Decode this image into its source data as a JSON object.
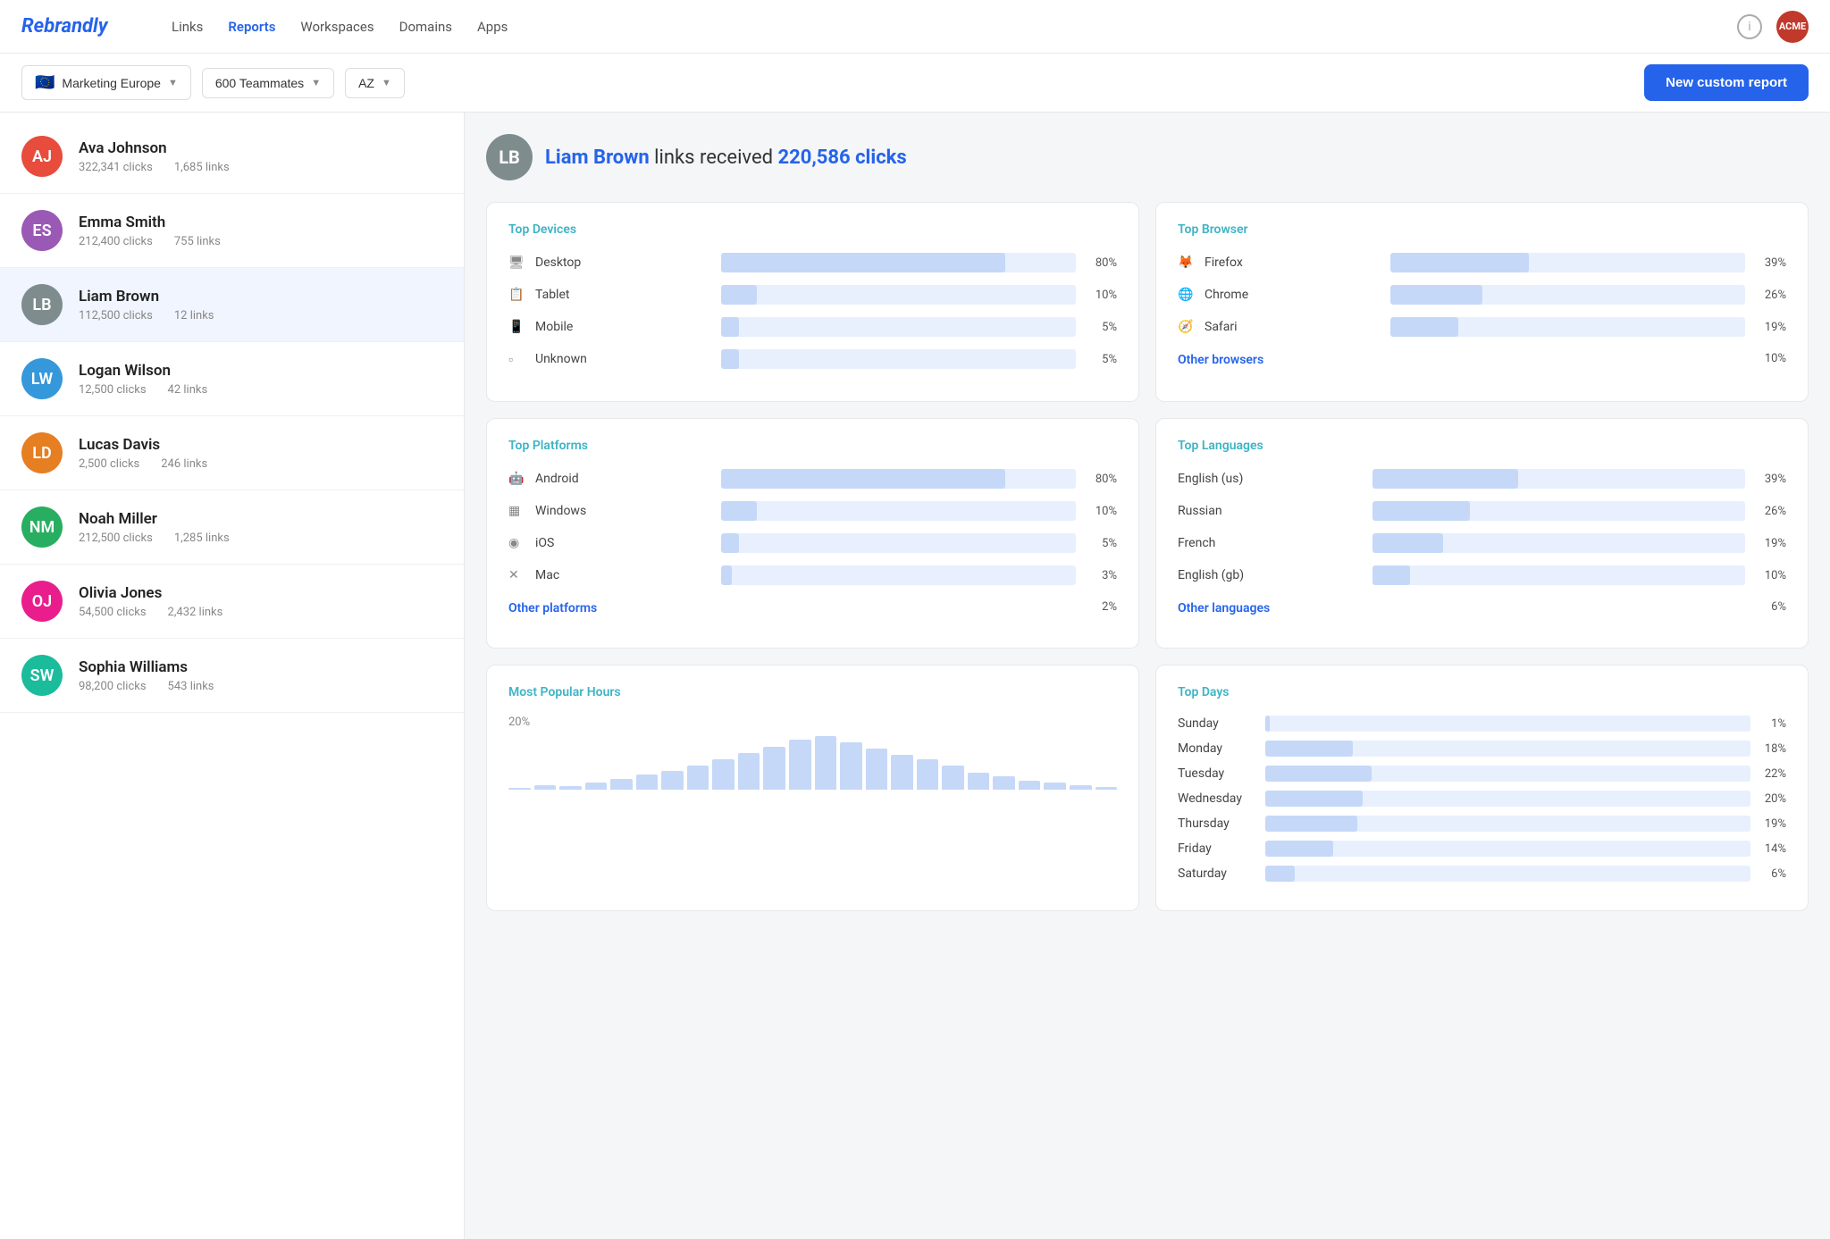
{
  "brand": "Rebrandly",
  "nav": {
    "links": [
      "Links",
      "Reports",
      "Workspaces",
      "Domains",
      "Apps"
    ],
    "active": "Reports"
  },
  "toolbar": {
    "workspace": "Marketing Europe",
    "teammates": "600 Teammates",
    "filter": "AZ",
    "new_report_label": "New custom report"
  },
  "users": [
    {
      "name": "Ava Johnson",
      "clicks": "322,341 clicks",
      "links": "1,685 links",
      "initials": "AJ",
      "color": "av-red"
    },
    {
      "name": "Emma Smith",
      "clicks": "212,400 clicks",
      "links": "755 links",
      "initials": "ES",
      "color": "av-purple"
    },
    {
      "name": "Liam Brown",
      "clicks": "112,500 clicks",
      "links": "12 links",
      "initials": "LB",
      "color": "av-gray",
      "selected": true
    },
    {
      "name": "Logan Wilson",
      "clicks": "12,500 clicks",
      "links": "42 links",
      "initials": "LW",
      "color": "av-blue"
    },
    {
      "name": "Lucas Davis",
      "clicks": "2,500 clicks",
      "links": "246 links",
      "initials": "LD",
      "color": "av-orange"
    },
    {
      "name": "Noah Miller",
      "clicks": "212,500 clicks",
      "links": "1,285 links",
      "initials": "NM",
      "color": "av-green"
    },
    {
      "name": "Olivia Jones",
      "clicks": "54,500 clicks",
      "links": "2,432 links",
      "initials": "OJ",
      "color": "av-pink"
    },
    {
      "name": "Sophia Williams",
      "clicks": "98,200 clicks",
      "links": "543 links",
      "initials": "SW",
      "color": "av-teal"
    }
  ],
  "selected_user": {
    "name": "Liam Brown",
    "clicks": "220,586 clicks",
    "initials": "LB",
    "color": "av-gray"
  },
  "top_devices": {
    "title": "Top Devices",
    "items": [
      {
        "label": "Desktop",
        "pct": 80,
        "pct_label": "80%"
      },
      {
        "label": "Tablet",
        "pct": 10,
        "pct_label": "10%"
      },
      {
        "label": "Mobile",
        "pct": 5,
        "pct_label": "5%"
      },
      {
        "label": "Unknown",
        "pct": 5,
        "pct_label": "5%"
      }
    ]
  },
  "top_browser": {
    "title": "Top Browser",
    "items": [
      {
        "label": "Firefox",
        "pct": 39,
        "pct_label": "39%"
      },
      {
        "label": "Chrome",
        "pct": 26,
        "pct_label": "26%"
      },
      {
        "label": "Safari",
        "pct": 19,
        "pct_label": "19%"
      }
    ],
    "other_label": "Other browsers",
    "other_pct": "10%"
  },
  "top_platforms": {
    "title": "Top Platforms",
    "items": [
      {
        "label": "Android",
        "pct": 80,
        "pct_label": "80%"
      },
      {
        "label": "Windows",
        "pct": 10,
        "pct_label": "10%"
      },
      {
        "label": "iOS",
        "pct": 5,
        "pct_label": "5%"
      },
      {
        "label": "Mac",
        "pct": 3,
        "pct_label": "3%"
      }
    ],
    "other_label": "Other platforms",
    "other_pct": "2%"
  },
  "top_languages": {
    "title": "Top Languages",
    "items": [
      {
        "label": "English (us)",
        "pct": 39,
        "pct_label": "39%"
      },
      {
        "label": "Russian",
        "pct": 26,
        "pct_label": "26%"
      },
      {
        "label": "French",
        "pct": 19,
        "pct_label": "19%"
      },
      {
        "label": "English (gb)",
        "pct": 10,
        "pct_label": "10%"
      }
    ],
    "other_label": "Other languages",
    "other_pct": "6%"
  },
  "most_popular_hours": {
    "title": "Most Popular Hours",
    "pct_label": "20%",
    "bars": [
      2,
      5,
      4,
      8,
      12,
      18,
      22,
      28,
      35,
      42,
      50,
      58,
      62,
      55,
      48,
      40,
      35,
      28,
      20,
      15,
      10,
      8,
      5,
      3
    ]
  },
  "top_days": {
    "title": "Top Days",
    "items": [
      {
        "label": "Sunday",
        "pct": 1,
        "pct_label": "1%"
      },
      {
        "label": "Monday",
        "pct": 18,
        "pct_label": "18%"
      },
      {
        "label": "Tuesday",
        "pct": 22,
        "pct_label": "22%"
      },
      {
        "label": "Wednesday",
        "pct": 20,
        "pct_label": "20%"
      },
      {
        "label": "Thursday",
        "pct": 19,
        "pct_label": "19%"
      },
      {
        "label": "Friday",
        "pct": 14,
        "pct_label": "14%"
      },
      {
        "label": "Saturday",
        "pct": 6,
        "pct_label": "6%"
      }
    ]
  }
}
